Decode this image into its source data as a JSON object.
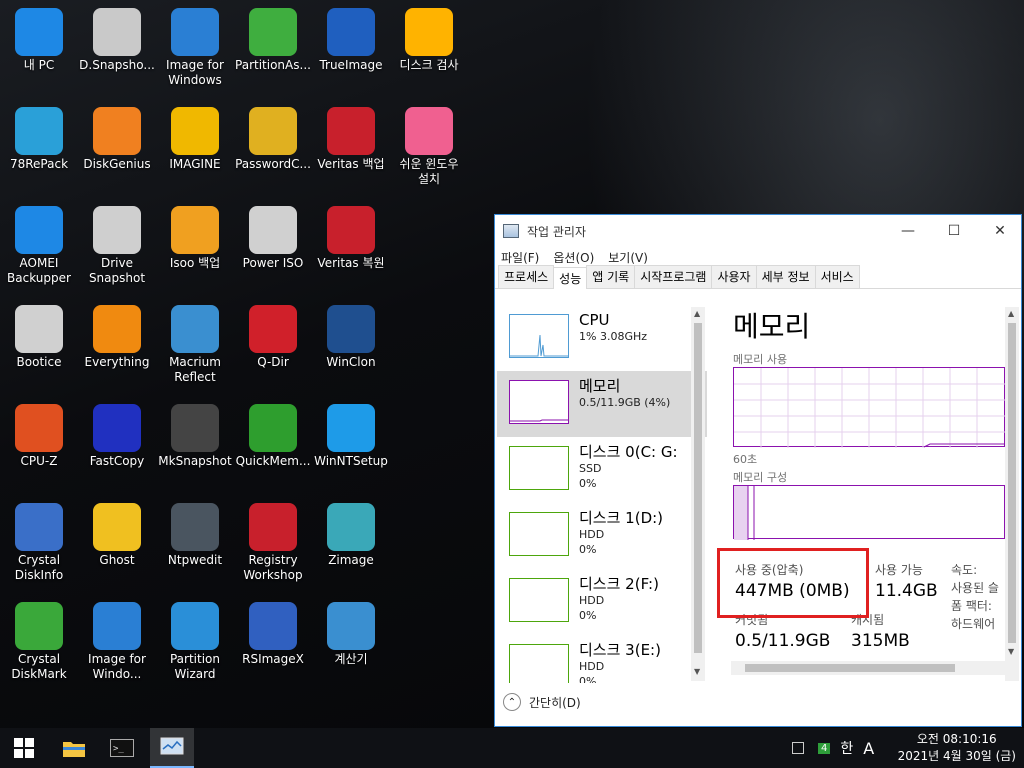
{
  "desktop": {
    "icons": [
      {
        "label": "내 PC",
        "icon": "monitor-icon",
        "color": "#1e88e5"
      },
      {
        "label": "D.Snapsho...",
        "icon": "drive-icon",
        "color": "#c9c9c9"
      },
      {
        "label": "Image for Windows",
        "icon": "computer-icon",
        "color": "#2a7fd4"
      },
      {
        "label": "PartitionAs...",
        "icon": "pie-icon",
        "color": "#3fae3f"
      },
      {
        "label": "TrueImage",
        "icon": "acronis-icon",
        "color": "#1f5fbf"
      },
      {
        "label": "디스크 검사",
        "icon": "windows-flag-icon",
        "color": "#ffb300"
      },
      {
        "label": "78RePack",
        "icon": "triangle-icon",
        "color": "#2aa0d8"
      },
      {
        "label": "DiskGenius",
        "icon": "disk-genius-icon",
        "color": "#f08020"
      },
      {
        "label": "IMAGINE",
        "icon": "sunflower-icon",
        "color": "#f0b800"
      },
      {
        "label": "PasswordC...",
        "icon": "key-icon",
        "color": "#e0b020"
      },
      {
        "label": "Veritas 백업",
        "icon": "veritas-backup-icon",
        "color": "#c8202c"
      },
      {
        "label": "쉬운 윈도우 설치",
        "icon": "windows-pink-icon",
        "color": "#f06090"
      },
      {
        "label": "AOMEI Backupper",
        "icon": "sync-icon",
        "color": "#1e88e5"
      },
      {
        "label": "Drive Snapshot",
        "icon": "camera-icon",
        "color": "#cfcfcf"
      },
      {
        "label": "Isoo 백업",
        "icon": "isoo-icon",
        "color": "#f0a020"
      },
      {
        "label": "Power ISO",
        "icon": "cd-icon",
        "color": "#d0d0d0"
      },
      {
        "label": "Veritas 복원",
        "icon": "veritas-restore-icon",
        "color": "#c8202c"
      },
      {
        "label": "Bootice",
        "icon": "bootice-icon",
        "color": "#d0d0d0"
      },
      {
        "label": "Everything",
        "icon": "magnifier-icon",
        "color": "#f08a10"
      },
      {
        "label": "Macrium Reflect",
        "icon": "macrium-icon",
        "color": "#3a8fd0"
      },
      {
        "label": "Q-Dir",
        "icon": "grid-icon",
        "color": "#d0202a"
      },
      {
        "label": "WinClon",
        "icon": "winclon-icon",
        "color": "#1f4f8f"
      },
      {
        "label": "CPU-Z",
        "icon": "chip-icon",
        "color": "#e05020"
      },
      {
        "label": "FastCopy",
        "icon": "fc-icon",
        "color": "#2030c0"
      },
      {
        "label": "MkSnapshot",
        "icon": "snapshot-icon",
        "color": "#444444"
      },
      {
        "label": "QuickMem...",
        "icon": "q-icon",
        "color": "#2e9e2e"
      },
      {
        "label": "WinNTSetup",
        "icon": "windows-blue-icon",
        "color": "#1e9be8"
      },
      {
        "label": "Crystal DiskInfo",
        "icon": "diskinfo-icon",
        "color": "#3a6fc8"
      },
      {
        "label": "Ghost",
        "icon": "ghost-icon",
        "color": "#f0c020"
      },
      {
        "label": "Ntpwedit",
        "icon": "ntpwedit-icon",
        "color": "#4a5560"
      },
      {
        "label": "Registry Workshop",
        "icon": "cubes-icon",
        "color": "#c8202c"
      },
      {
        "label": "Zimage",
        "icon": "shield-icon",
        "color": "#3aa8b8"
      },
      {
        "label": "Crystal DiskMark",
        "icon": "diskmark-icon",
        "color": "#3aa83a"
      },
      {
        "label": "Image for Windo...",
        "icon": "computer-icon",
        "color": "#2a7fd4"
      },
      {
        "label": "Partition Wizard",
        "icon": "wizard-icon",
        "color": "#2a8fd8"
      },
      {
        "label": "RSImageX",
        "icon": "laptop-gear-icon",
        "color": "#3060c0"
      },
      {
        "label": "계산기",
        "icon": "calculator-icon",
        "color": "#3a8fd0"
      }
    ]
  },
  "taskmanager": {
    "title": "작업 관리자",
    "menu": [
      "파일(F)",
      "옵션(O)",
      "보기(V)"
    ],
    "tabs": [
      "프로세스",
      "성능",
      "앱 기록",
      "시작프로그램",
      "사용자",
      "세부 정보",
      "서비스"
    ],
    "active_tab": 1,
    "perf_items": [
      {
        "name": "CPU",
        "sub1": "1% 3.08GHz",
        "sub2": "",
        "color": "#4f9bd3"
      },
      {
        "name": "메모리",
        "sub1": "0.5/11.9GB (4%)",
        "sub2": "",
        "color": "#8b12ae"
      },
      {
        "name": "디스크 0(C: G:",
        "sub1": "SSD",
        "sub2": "0%",
        "color": "#4da60c"
      },
      {
        "name": "디스크 1(D:)",
        "sub1": "HDD",
        "sub2": "0%",
        "color": "#4da60c"
      },
      {
        "name": "디스크 2(F:)",
        "sub1": "HDD",
        "sub2": "0%",
        "color": "#4da60c"
      },
      {
        "name": "디스크 3(E:)",
        "sub1": "HDD",
        "sub2": "0%",
        "color": "#4da60c"
      }
    ],
    "memory": {
      "heading": "메모리",
      "usage_label": "메모리 사용",
      "time_label": "60초",
      "composition_label": "메모리 구성",
      "in_use_label": "사용 중(압축)",
      "in_use_value": "447MB (0MB)",
      "available_label": "사용 가능",
      "available_value": "11.4GB",
      "speed_label": "속도:",
      "slots_label": "사용된 슬",
      "form_label": "폼 팩터:",
      "hw_label": "하드웨어",
      "committed_label": "커밋됨",
      "committed_value": "0.5/11.9GB",
      "cached_label": "캐시됨",
      "cached_value": "315MB"
    },
    "footer_label": "간단히(D)"
  },
  "taskbar": {
    "tray_badge": "4",
    "ime": "A",
    "clock_time": "오전 08:10:16",
    "clock_date": "2021년 4월 30일 (금)"
  }
}
